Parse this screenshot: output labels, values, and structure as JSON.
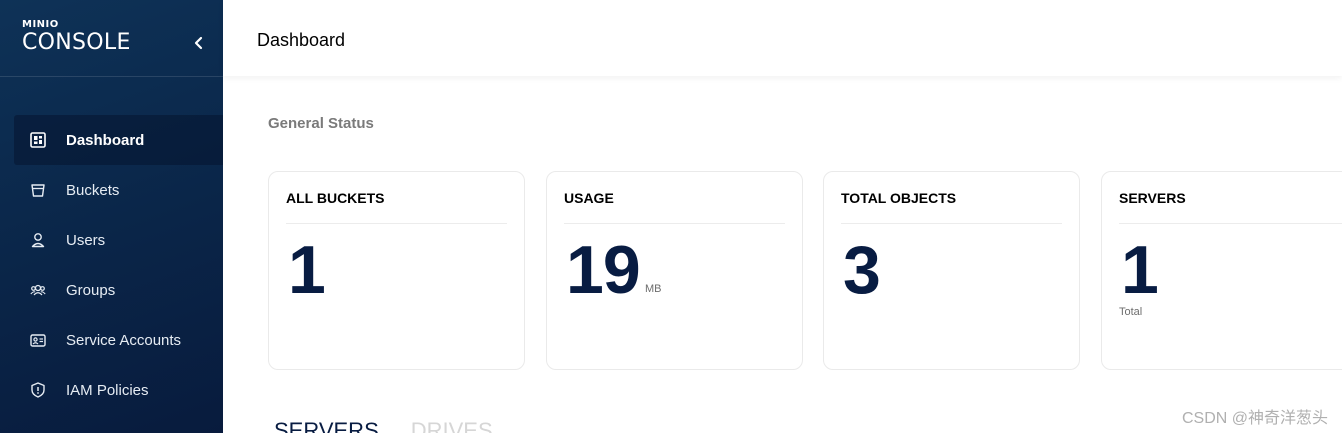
{
  "brand": {
    "small": "MINIO",
    "big": "CONSOLE"
  },
  "sidebar": {
    "items": [
      {
        "label": "Dashboard",
        "icon": "dashboard-icon",
        "active": true
      },
      {
        "label": "Buckets",
        "icon": "bucket-icon"
      },
      {
        "label": "Users",
        "icon": "user-icon"
      },
      {
        "label": "Groups",
        "icon": "groups-icon"
      },
      {
        "label": "Service Accounts",
        "icon": "service-accounts-icon"
      },
      {
        "label": "IAM Policies",
        "icon": "shield-icon"
      }
    ]
  },
  "header": {
    "title": "Dashboard"
  },
  "main": {
    "section_title": "General Status",
    "cards": [
      {
        "title": "ALL BUCKETS",
        "value": "1"
      },
      {
        "title": "USAGE",
        "value": "19",
        "unit": "MB"
      },
      {
        "title": "TOTAL OBJECTS",
        "value": "3"
      },
      {
        "title": "SERVERS",
        "value": "1",
        "sub": "Total"
      }
    ],
    "tabs": [
      {
        "label": "SERVERS",
        "active": true
      },
      {
        "label": "DRIVES",
        "active": false
      }
    ]
  },
  "watermark": "CSDN @神奇洋葱头",
  "colors": {
    "sidebar": "#0a2548",
    "value": "#081c42"
  }
}
